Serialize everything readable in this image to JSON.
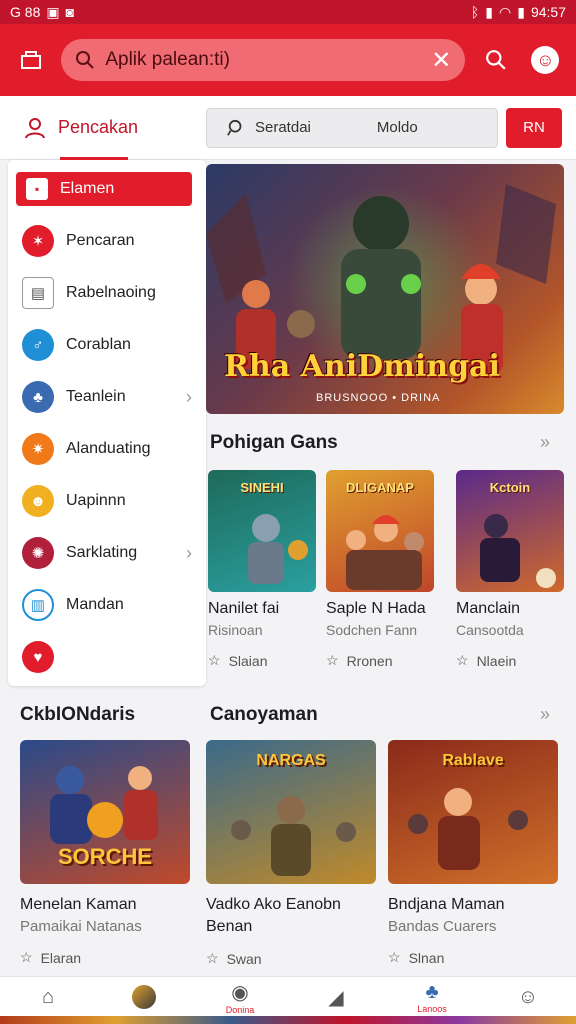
{
  "status": {
    "left": "G 88",
    "right": "94:57"
  },
  "search": {
    "query": "Aplik palean:ti)"
  },
  "tabs": {
    "active_label": "Pencakan",
    "filter_left": "Seratdai",
    "filter_right": "Moldo",
    "button_label": "RN"
  },
  "sidebar": {
    "items": [
      {
        "label": "Elamen",
        "icon": "flag-icon",
        "color": "#e11d2b"
      },
      {
        "label": "Pencaran",
        "icon": "burst-icon",
        "color": "#e11d2b"
      },
      {
        "label": "Rabelnaoing",
        "icon": "printer-icon",
        "color": "#555555"
      },
      {
        "label": "Corablan",
        "icon": "run-icon",
        "color": "#1f8fd6"
      },
      {
        "label": "Teanlein",
        "icon": "team-icon",
        "color": "#3a6ab0"
      },
      {
        "label": "Alanduating",
        "icon": "star-burst-icon",
        "color": "#f07a1a"
      },
      {
        "label": "Uapinnn",
        "icon": "people-icon",
        "color": "#f0b020"
      },
      {
        "label": "Sarklating",
        "icon": "swirl-icon",
        "color": "#b0203a"
      },
      {
        "label": "Mandan",
        "icon": "chart-icon",
        "color": "#1f8fd6"
      },
      {
        "label": "",
        "icon": "heart-icon",
        "color": "#e11d2b"
      }
    ]
  },
  "hero": {
    "title": "Rha AniDmingai",
    "subtitle": "BRUSNOOO • DRINA"
  },
  "popular": {
    "heading": "Pohigan Gans",
    "cards": [
      {
        "title": "Nanilet fai",
        "sub": "Risinoan",
        "rating": "Slaian",
        "thumb_label": "SINEHI",
        "bg1": "#1e6a5a",
        "bg2": "#2aa0a0"
      },
      {
        "title": "Saple N Hada",
        "sub": "Sodchen Fann",
        "rating": "Rronen",
        "thumb_label": "DLIGANAP",
        "bg1": "#e0a030",
        "bg2": "#c0452a"
      },
      {
        "title": "Manclain",
        "sub": "Cansootda",
        "rating": "Nlaein",
        "thumb_label": "Kctoin",
        "bg1": "#5a2a8a",
        "bg2": "#d06a2a"
      }
    ]
  },
  "lower": {
    "left_heading": "CkbIONdaris",
    "right_heading": "Canoyaman",
    "cards": [
      {
        "title": "Menelan Kaman",
        "sub": "Pamaikai Natanas",
        "rating": "Elaran",
        "thumb_label": "SORCHE",
        "bg1": "#2a4a8a",
        "bg2": "#c04a2a"
      },
      {
        "title": "Vadko Ako Eanobn",
        "title2": "Benan",
        "sub": "",
        "rating": "Swan",
        "thumb_label": "NARGAS",
        "bg1": "#3a6a8a",
        "bg2": "#c08a2a"
      },
      {
        "title": "Bndjana Maman",
        "sub": "Bandas Cuarers",
        "rating": "Slnan",
        "thumb_label": "Rablave",
        "bg1": "#8a2a1a",
        "bg2": "#d0702a"
      }
    ]
  },
  "bottomnav": {
    "items": [
      {
        "label": "",
        "icon": "home-icon"
      },
      {
        "label": "",
        "icon": "game-icon"
      },
      {
        "label": "Donina",
        "icon": "chat-icon"
      },
      {
        "label": "",
        "icon": "signal-icon"
      },
      {
        "label": "Lanoos",
        "icon": "group-icon"
      },
      {
        "label": "",
        "icon": "controller-icon"
      }
    ]
  }
}
